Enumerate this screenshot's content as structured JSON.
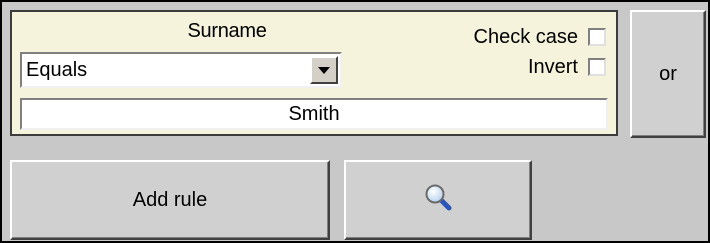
{
  "rule": {
    "field_label": "Surname",
    "operator": "Equals",
    "check_case_label": "Check case",
    "invert_label": "Invert",
    "check_case_checked": false,
    "invert_checked": false,
    "value": "Smith"
  },
  "buttons": {
    "or_label": "or",
    "add_rule_label": "Add rule",
    "search_icon": "magnifier-icon"
  }
}
